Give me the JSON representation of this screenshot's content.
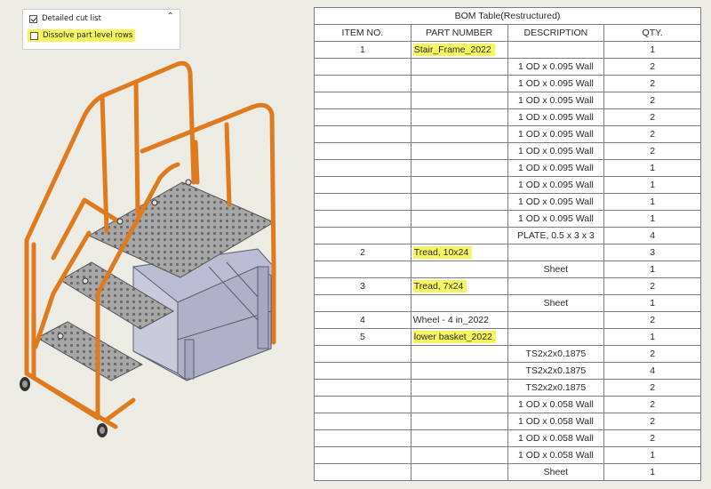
{
  "panel": {
    "detailed_cut_list": "Detailed cut list",
    "dissolve_rows": "Dissolve part level rows",
    "highlight_color": "#f5f560"
  },
  "model": {
    "frame_color": "#e07a1e",
    "basket_color": "#b9bcd2",
    "tread_color": "#a6a6a6"
  },
  "bom": {
    "title": "BOM Table(Restructured)",
    "headers": {
      "item": "ITEM NO.",
      "part": "PART NUMBER",
      "desc": "DESCRIPTION",
      "qty": "QTY."
    },
    "rows": [
      {
        "item": "1",
        "part": "Stair_Frame_2022",
        "desc": "",
        "qty": "1"
      },
      {
        "item": "",
        "part": "",
        "desc": "1 OD x 0.095 Wall",
        "qty": "2"
      },
      {
        "item": "",
        "part": "",
        "desc": "1 OD x 0.095 Wall",
        "qty": "2"
      },
      {
        "item": "",
        "part": "",
        "desc": "1 OD x 0.095 Wall",
        "qty": "2"
      },
      {
        "item": "",
        "part": "",
        "desc": "1 OD x 0.095 Wall",
        "qty": "2"
      },
      {
        "item": "",
        "part": "",
        "desc": "1 OD x 0.095 Wall",
        "qty": "2"
      },
      {
        "item": "",
        "part": "",
        "desc": "1 OD x 0.095 Wall",
        "qty": "2"
      },
      {
        "item": "",
        "part": "",
        "desc": "1 OD x 0.095 Wall",
        "qty": "1"
      },
      {
        "item": "",
        "part": "",
        "desc": "1 OD x 0.095 Wall",
        "qty": "1"
      },
      {
        "item": "",
        "part": "",
        "desc": "1 OD x 0.095 Wall",
        "qty": "1"
      },
      {
        "item": "",
        "part": "",
        "desc": "1 OD x 0.095 Wall",
        "qty": "1"
      },
      {
        "item": "",
        "part": "",
        "desc": "PLATE, 0.5 x 3 x 3",
        "qty": "4"
      },
      {
        "item": "2",
        "part": "Tread, 10x24",
        "desc": "",
        "qty": "3"
      },
      {
        "item": "",
        "part": "",
        "desc": "Sheet",
        "qty": "1"
      },
      {
        "item": "3",
        "part": "Tread, 7x24",
        "desc": "",
        "qty": "2"
      },
      {
        "item": "",
        "part": "",
        "desc": "Sheet",
        "qty": "1"
      },
      {
        "item": "4",
        "part": "Wheel - 4 in_2022",
        "desc": "",
        "qty": "2"
      },
      {
        "item": "5",
        "part": "lower basket_2022",
        "desc": "",
        "qty": "1"
      },
      {
        "item": "",
        "part": "",
        "desc": "TS2x2x0.1875",
        "qty": "2"
      },
      {
        "item": "",
        "part": "",
        "desc": "TS2x2x0.1875",
        "qty": "4"
      },
      {
        "item": "",
        "part": "",
        "desc": "TS2x2x0.1875",
        "qty": "2"
      },
      {
        "item": "",
        "part": "",
        "desc": "1 OD x 0.058 Wall",
        "qty": "2"
      },
      {
        "item": "",
        "part": "",
        "desc": "1 OD x 0.058 Wall",
        "qty": "2"
      },
      {
        "item": "",
        "part": "",
        "desc": "1 OD x 0.058 Wall",
        "qty": "2"
      },
      {
        "item": "",
        "part": "",
        "desc": "1 OD x 0.058 Wall",
        "qty": "1"
      },
      {
        "item": "",
        "part": "",
        "desc": "Sheet",
        "qty": "1"
      }
    ],
    "highlighted_rows": [
      0,
      12,
      14,
      17
    ]
  }
}
